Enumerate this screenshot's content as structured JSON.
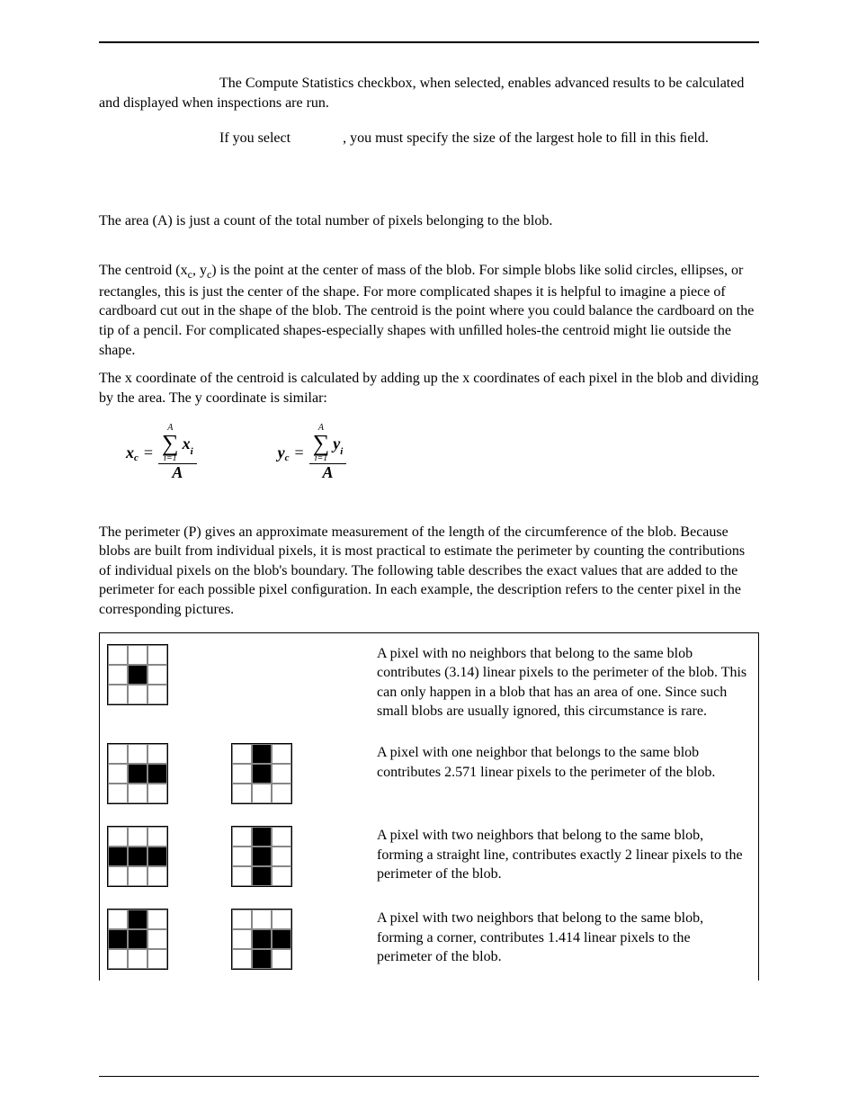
{
  "intro": {
    "p1_prefix": "",
    "p1": "The Compute Statistics checkbox, when selected, enables advanced results to be calculated and displayed when inspections are run.",
    "p2a": "If you select ",
    "p2b": ", you must specify the size of the largest hole to ﬁll in this ﬁeld."
  },
  "area": {
    "p": "The area (A) is just a count of the total number of pixels belonging to the blob."
  },
  "centroid": {
    "p1": "The centroid (xc, yc) is the point at the center of mass of the blob. For simple blobs like solid circles, ellipses, or rectangles, this is just the center of the shape. For more complicated shapes it is helpful to imagine a piece of cardboard cut out in the shape of the blob. The centroid is the point where you could balance the cardboard on the tip of a pencil. For complicated shapes-especially shapes with unﬁlled holes-the centroid might lie outside the shape.",
    "p2": "The x coordinate of the centroid is calculated by adding up the x coordinates of each pixel in the blob and dividing by the area. The y coordinate is similar:",
    "eq": {
      "sum_top": "A",
      "sum_bottom": "i=1",
      "xc_label": "x",
      "xc_sub": "c",
      "xi_label": "x",
      "xi_sub": "i",
      "yc_label": "y",
      "yc_sub": "c",
      "yi_label": "y",
      "yi_sub": "i",
      "den": "A"
    }
  },
  "perimeter": {
    "p": "The perimeter (P) gives an approximate measurement of the length of the circumference of the blob. Because blobs are built from individual pixels, it is most practical to estimate the perimeter by counting the contributions of individual pixels on the blob's boundary. The following table describes the exact values that are added to the perimeter for each possible pixel conﬁguration. In each example, the description refers to the center pixel in the corresponding pictures."
  },
  "table": {
    "rows": [
      {
        "desc": "A pixel with no neighbors that belong to the same blob contributes  (3.14) linear pixels to the perimeter of the blob. This can only happen in a blob that has an area of one. Since such small blobs are usually ignored, this circumstance is rare.",
        "grids": [
          [
            0,
            0,
            0,
            0,
            1,
            0,
            0,
            0,
            0
          ]
        ]
      },
      {
        "desc": "A pixel with one neighbor that belongs to the same blob contributes 2.571 linear pixels to the perimeter of the blob.",
        "grids": [
          [
            0,
            0,
            0,
            0,
            1,
            1,
            0,
            0,
            0
          ],
          [
            0,
            1,
            0,
            0,
            1,
            0,
            0,
            0,
            0
          ]
        ]
      },
      {
        "desc": "A pixel with two neighbors that belong to the same blob, forming a straight line, contributes exactly 2 linear pixels to the perimeter of the blob.",
        "grids": [
          [
            0,
            0,
            0,
            1,
            1,
            1,
            0,
            0,
            0
          ],
          [
            0,
            1,
            0,
            0,
            1,
            0,
            0,
            1,
            0
          ]
        ]
      },
      {
        "desc": "A pixel with two neighbors that belong to the same blob, forming a corner, contributes 1.414 linear pixels to the perimeter of the blob.",
        "grids": [
          [
            0,
            1,
            0,
            1,
            1,
            0,
            0,
            0,
            0
          ],
          [
            0,
            0,
            0,
            0,
            1,
            1,
            0,
            1,
            0
          ]
        ]
      }
    ]
  }
}
